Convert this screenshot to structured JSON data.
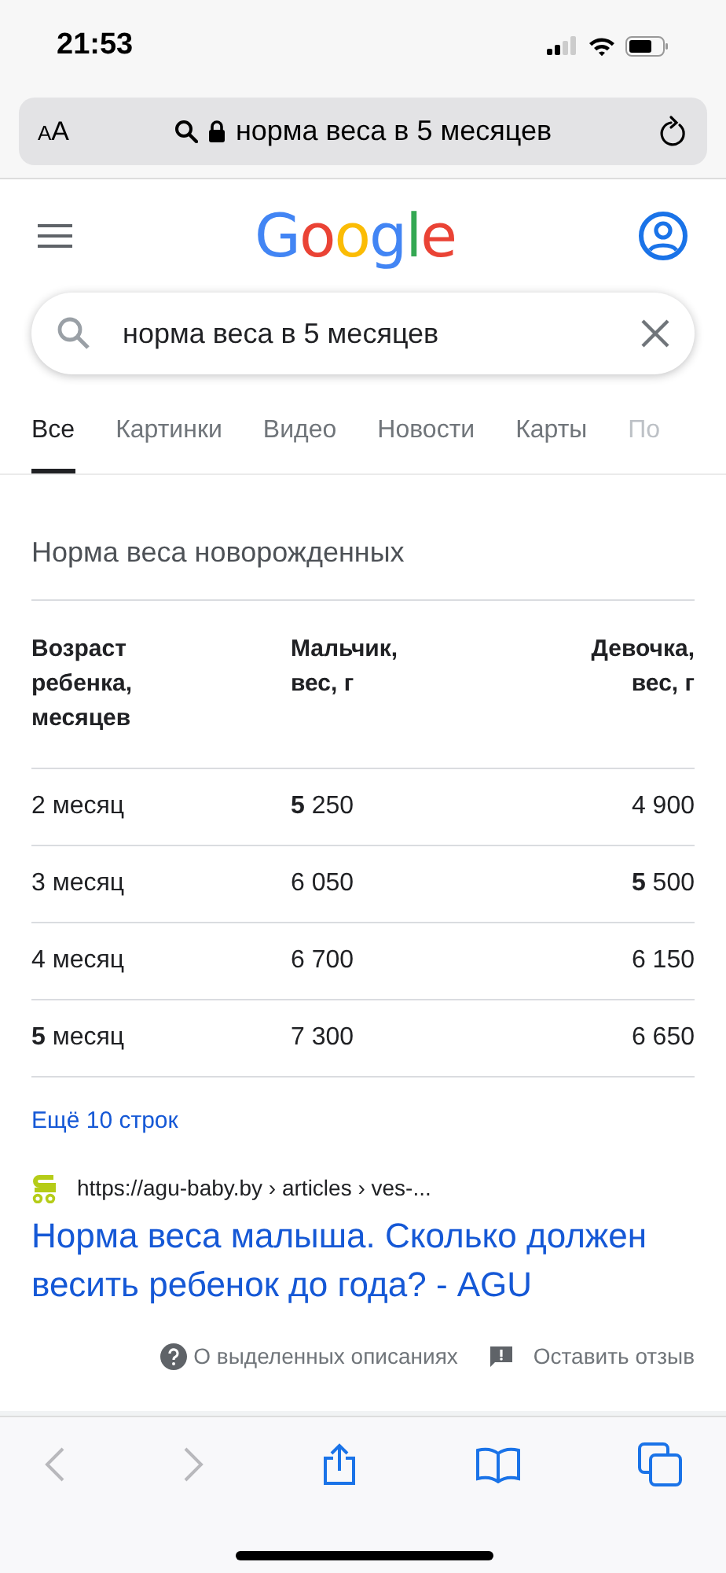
{
  "status_bar": {
    "time": "21:53"
  },
  "browser": {
    "text_size": "AA",
    "address": "норма веса в 5 месяцев"
  },
  "google": {
    "logo": "Google",
    "query": "норма веса в 5 месяцев"
  },
  "tabs": [
    {
      "label": "Все",
      "selected": true
    },
    {
      "label": "Картинки",
      "selected": false
    },
    {
      "label": "Видео",
      "selected": false
    },
    {
      "label": "Новости",
      "selected": false
    },
    {
      "label": "Карты",
      "selected": false
    },
    {
      "label": "По",
      "selected": false
    }
  ],
  "snippet": {
    "title": "Норма веса новорожденных",
    "columns": [
      "Возраст ребенка, месяцев",
      "Мальчик, вес, г",
      "Девочка, вес, г"
    ],
    "rows": [
      [
        "2 месяц",
        "**5** 250",
        "4 900"
      ],
      [
        "3 месяц",
        "6 050",
        "**5** 500"
      ],
      [
        "4 месяц",
        "6 700",
        "6 150"
      ],
      [
        "**5** месяц",
        "7 300",
        "6 650"
      ]
    ],
    "more": "Ещё 10 строк"
  },
  "result": {
    "url": "https://agu-baby.by › articles › ves-...",
    "title": "Норма веса малыша. Сколько должен весить ребенок до года? - AGU"
  },
  "feedback": [
    "О выделенных описаниях",
    "Оставить отзыв"
  ]
}
